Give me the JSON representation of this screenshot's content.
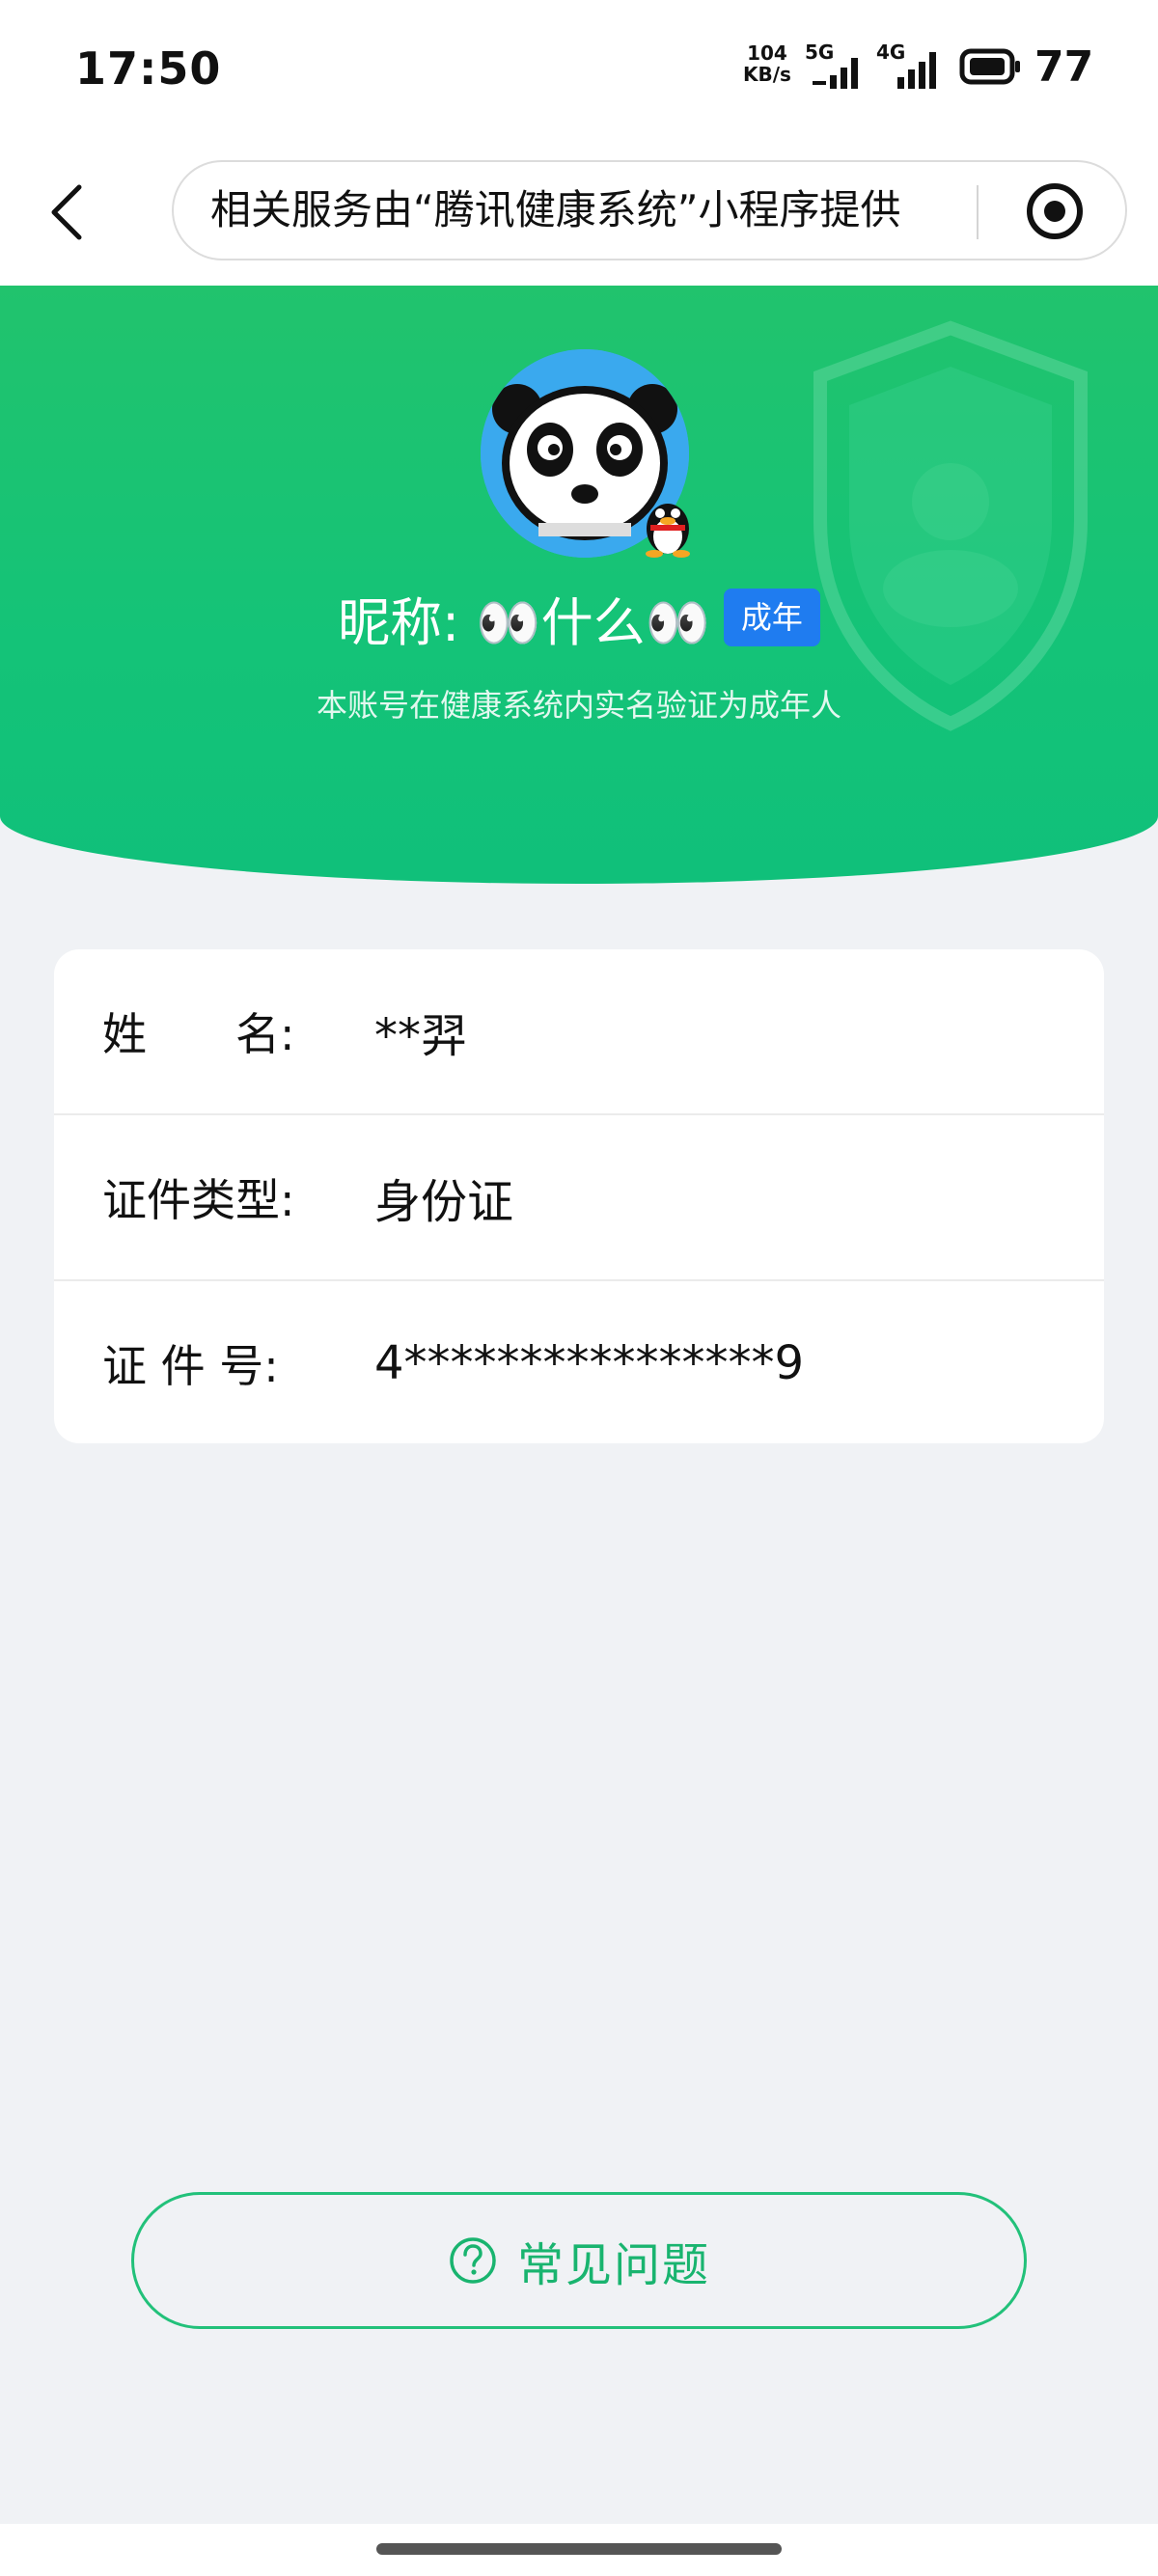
{
  "status_bar": {
    "time": "17:50",
    "net_speed_value": "104",
    "net_speed_unit": "KB/s",
    "signal_1": "5G",
    "signal_2": "4G",
    "battery": "77"
  },
  "nav": {
    "title": "相关服务由“腾讯健康系统”小程序提供",
    "back_icon": "chevron-left-icon",
    "target_icon": "target-icon"
  },
  "profile": {
    "nickname": "昵称: 👀什么👀",
    "badge": "成年",
    "verify_text": "本账号在健康系统内实名验证为成年人"
  },
  "info_rows": [
    {
      "label": "姓　　名:",
      "value": "**羿"
    },
    {
      "label": "证件类型:",
      "value": "身份证"
    },
    {
      "label": "证 件 号:",
      "value": "4****************9"
    }
  ],
  "faq": {
    "label": "常见问题"
  },
  "colors": {
    "accent_green": "#19b46f",
    "header_green": "#14c378",
    "badge_blue": "#1f7cf0"
  }
}
